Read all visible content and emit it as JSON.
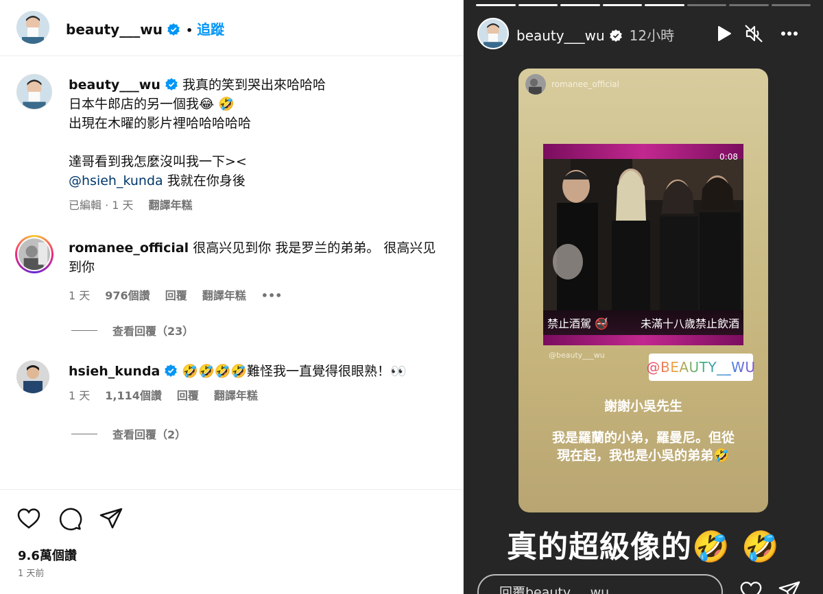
{
  "post": {
    "header": {
      "username": "beauty___wu",
      "separator": "•",
      "follow_label": "追蹤"
    },
    "caption": {
      "username": "beauty___wu",
      "line1": "我真的笑到哭出來哈哈哈",
      "line2": "日本牛郎店的另一個我😂 🤣",
      "line3": "出現在木曜的影片裡哈哈哈哈哈",
      "line4": "達哥看到我怎麼沒叫我一下><",
      "mention": "@hsieh_kunda",
      "line5_rest": " 我就在你身後",
      "meta": {
        "edited": "已編輯 · 1 天",
        "translate": "翻譯年糕"
      }
    },
    "comments": [
      {
        "username": "romanee_official",
        "text_line1": "很高兴见到你 我是罗兰的弟弟。 很高兴见",
        "text_line2": "到你",
        "time": "1 天",
        "likes": "976個讚",
        "reply": "回覆",
        "translate": "翻譯年糕",
        "more": "•••",
        "view_replies": "查看回覆（23）"
      },
      {
        "username": "hsieh_kunda",
        "text": "🤣🤣🤣🤣難怪我一直覺得很眼熟！👀",
        "time": "1 天",
        "likes": "1,114個讚",
        "reply": "回覆",
        "translate": "翻譯年糕",
        "view_replies": "查看回覆（2）"
      }
    ],
    "likes_count": "9.6萬個讚",
    "posted_ago": "1 天前"
  },
  "story": {
    "username": "beauty___wu",
    "time": "12小時",
    "card": {
      "source_user": "romanee_official",
      "timecode": "0:08",
      "subtitle_left": "禁止酒駕 🚭",
      "subtitle_right": "未滿十八歲禁止飲酒",
      "handle_watermark": "@beauty___wu",
      "sticker": "@BEAUTY__WU",
      "thanks": "謝謝小吳先生",
      "message_line1": "我是羅蘭的小弟，羅曼尼。但從",
      "message_line2": "現在起，我也是小吳的弟弟🤣"
    },
    "overlay_text": "真的超級像的🤣 🤣",
    "reply_placeholder": "回覆beauty___wu...",
    "progress": {
      "segments": 8,
      "completed": 5
    }
  },
  "colors": {
    "accent_blue": "#0095f6",
    "mention": "#00376b",
    "muted": "#737373",
    "story_bg": "#262626"
  }
}
